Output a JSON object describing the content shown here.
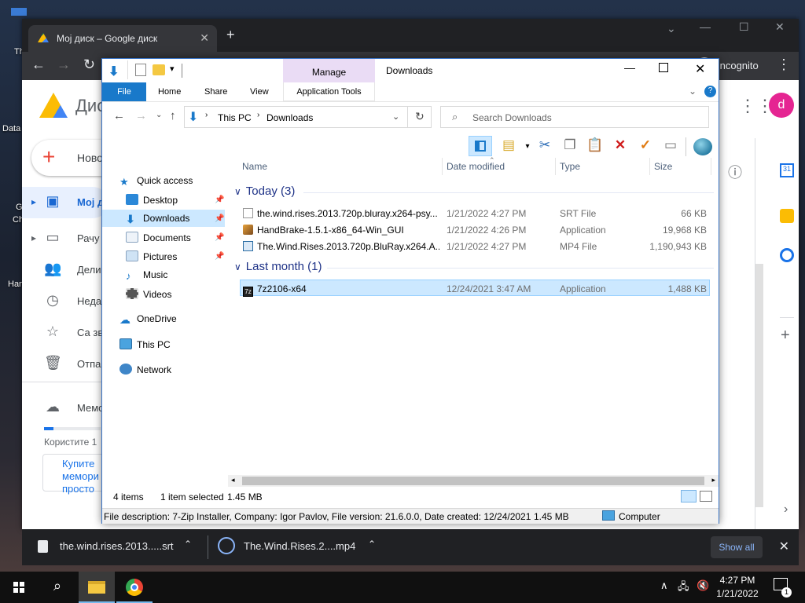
{
  "chrome": {
    "tab_title": "Мој диск – Google диск",
    "incognito_label": "Incognito",
    "new_tab": "+"
  },
  "gdrive": {
    "logo_text": "Дис",
    "new_button": "Ново",
    "nav": [
      "Мој д",
      "Рачу",
      "Дели",
      "Неда",
      "Са зв",
      "Отпа"
    ],
    "storage_label": "Мемо",
    "usage_text": "Користите 1",
    "buy_storage": [
      "Купите",
      "мемори",
      "просто"
    ],
    "avatar_letter": "d"
  },
  "desktop_icons": [
    "Th",
    "Data",
    "G",
    "Ch",
    "Han"
  ],
  "explorer": {
    "title": "Downloads",
    "manage_tab": "Manage",
    "ribbon_tabs": [
      "File",
      "Home",
      "Share",
      "View",
      "Application Tools"
    ],
    "address": {
      "root": "This PC",
      "folder": "Downloads"
    },
    "search_placeholder": "Search Downloads",
    "nav_items": [
      {
        "label": "Quick access",
        "icon": "star-icon"
      },
      {
        "label": "Desktop",
        "icon": "desktop-icon"
      },
      {
        "label": "Downloads",
        "icon": "download-arrow-icon"
      },
      {
        "label": "Documents",
        "icon": "document-icon"
      },
      {
        "label": "Pictures",
        "icon": "picture-icon"
      },
      {
        "label": "Music",
        "icon": "music-note-icon"
      },
      {
        "label": "Videos",
        "icon": "film-icon"
      },
      {
        "label": "OneDrive",
        "icon": "cloud-icon"
      },
      {
        "label": "This PC",
        "icon": "monitor-icon"
      },
      {
        "label": "Network",
        "icon": "network-icon"
      }
    ],
    "columns": [
      "Name",
      "Date modified",
      "Type",
      "Size"
    ],
    "groups": [
      {
        "label": "Today (3)",
        "files": [
          {
            "name": "the.wind.rises.2013.720p.bluray.x264-psy...",
            "date": "1/21/2022 4:27 PM",
            "type": "SRT File",
            "size": "66 KB"
          },
          {
            "name": "HandBrake-1.5.1-x86_64-Win_GUI",
            "date": "1/21/2022 4:26 PM",
            "type": "Application",
            "size": "19,968 KB"
          },
          {
            "name": "The.Wind.Rises.2013.720p.BluRay.x264.A...",
            "date": "1/21/2022 4:27 PM",
            "type": "MP4 File",
            "size": "1,190,943 KB"
          }
        ]
      },
      {
        "label": "Last month (1)",
        "files": [
          {
            "name": "7z2106-x64",
            "date": "12/24/2021 3:47 AM",
            "type": "Application",
            "size": "1,488 KB"
          }
        ]
      }
    ],
    "status": {
      "count": "4 items",
      "selected": "1 item selected",
      "size": "1.45 MB"
    },
    "details": {
      "description": "File description: 7-Zip Installer, Company: Igor Pavlov, File version: 21.6.0.0, Date created: 12/24/2021 3:4",
      "size": "1.45 MB",
      "location": "Computer"
    }
  },
  "downloads_bar": {
    "items": [
      "the.wind.rises.2013.....srt",
      "The.Wind.Rises.2....mp4"
    ],
    "show_all": "Show all"
  },
  "taskbar": {
    "time": "4:27 PM",
    "date": "1/21/2022",
    "notification_count": "1"
  }
}
